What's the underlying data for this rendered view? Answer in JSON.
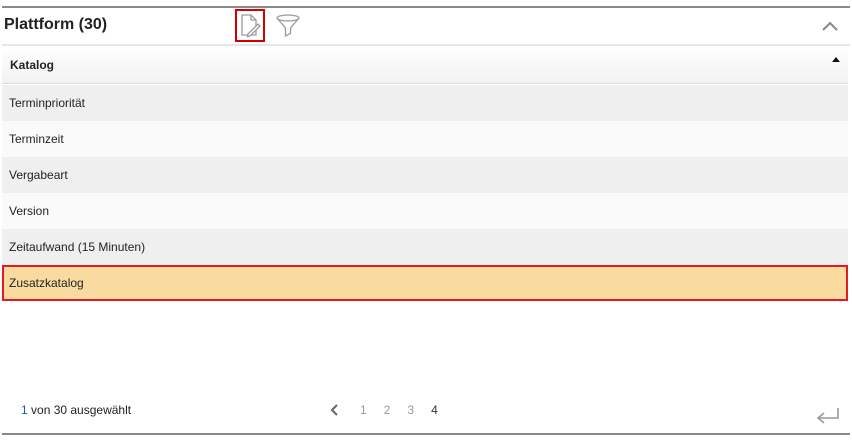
{
  "header": {
    "title": "Plattform (30)",
    "tools": [
      {
        "icon": "edit-document-icon",
        "highlighted": true
      },
      {
        "icon": "filter-icon",
        "highlighted": false
      }
    ],
    "collapse_icon": "chevron-up-icon"
  },
  "table": {
    "column_header": "Katalog",
    "sort": "ascending",
    "rows": [
      {
        "label": "Terminpriorität"
      },
      {
        "label": "Terminzeit"
      },
      {
        "label": "Vergabeart"
      },
      {
        "label": "Version"
      },
      {
        "label": "Zeitaufwand (15 Minuten)"
      },
      {
        "label": "Zusatzkatalog",
        "selected": true
      }
    ]
  },
  "footer": {
    "selected_count": "1",
    "selected_text": " von 30 ausgewählt",
    "pages": [
      "1",
      "2",
      "3",
      "4"
    ],
    "current_page": "4",
    "prev_icon": "chevron-left-icon",
    "return_icon": "return-arrow-icon"
  },
  "colors": {
    "selection_fill": "#fadb9f",
    "selection_border": "#e11b22",
    "highlight_border": "#d40000",
    "row_alt": "#efefef"
  }
}
